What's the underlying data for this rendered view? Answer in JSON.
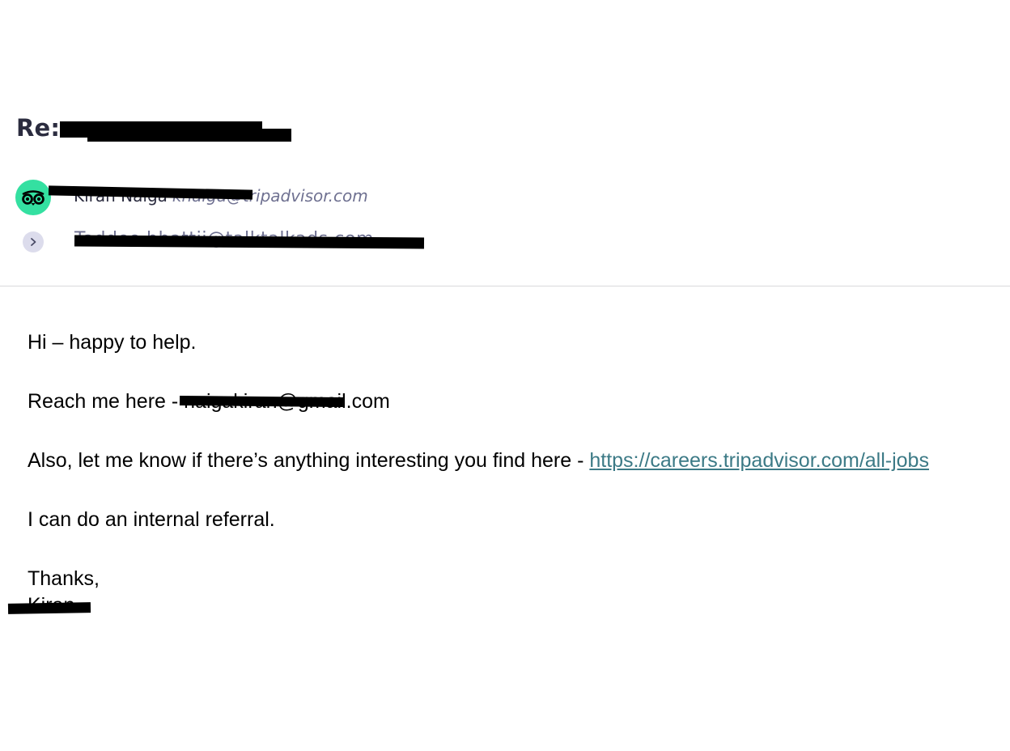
{
  "email": {
    "subject": "Re: co",
    "from": {
      "name": "Kiran Naiga",
      "email": "knaiga@tripadvisor.com",
      "avatar_icon": "tripadvisor-owl-icon",
      "avatar_color": "#34e0a1"
    },
    "to": {
      "email": "Taddeo.bhattii@talktalkads.com",
      "expand_icon": "chevron-right-icon"
    },
    "body": {
      "greeting": "Hi – happy to help.",
      "reach_prefix": "Reach me here - ",
      "reach_email": "naigakiran@gmail.com",
      "also_text": "Also, let me know if there’s anything interesting you find here - ",
      "careers_link": "https://careers.tripadvisor.com/all-jobs",
      "referral": "I can do an internal referral.",
      "signoff": "Thanks,",
      "signature": "Kiran"
    }
  }
}
